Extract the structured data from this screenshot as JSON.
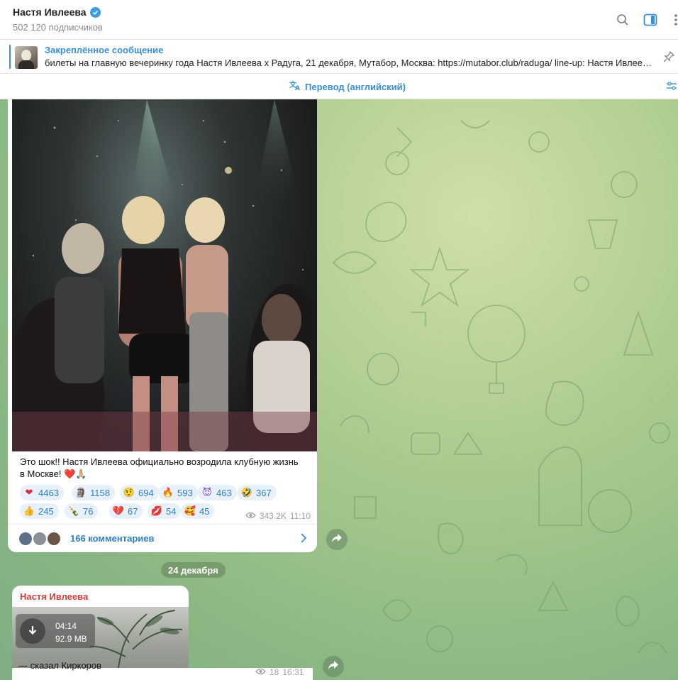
{
  "header": {
    "channel_name": "Настя Ивлеева",
    "subscribers": "502 120 подписчиков",
    "icons": [
      "search-icon",
      "sidebar-toggle-icon",
      "more-icon"
    ]
  },
  "pinned": {
    "title": "Закреплённое сообщение",
    "text": "билеты на главную вечеринку года Настя Ивлеева х Радуга, 21 декабря, Мутабор, Москва:   https://mutabor.club/raduga/  line-up:   Настя Ивлеева, Тимур..."
  },
  "translate": {
    "label": "Перевод (английский)"
  },
  "message1": {
    "caption_line1": "Это шок!! Настя Ивлеева официально возродила клубную жизнь",
    "caption_line2": "в Москве! ❤️🙏🏼",
    "reactions": [
      {
        "emoji": "❤",
        "count": "4463",
        "color": "#e0283a"
      },
      {
        "emoji": "🗿",
        "count": "1158",
        "color": "#777777"
      },
      {
        "emoji": "🤨",
        "count": "694",
        "color": "#e8b422"
      },
      {
        "emoji": "🔥",
        "count": "593",
        "color": "#f06a1d"
      },
      {
        "emoji": "😈",
        "count": "463",
        "color": "#8a4fc8"
      },
      {
        "emoji": "🤣",
        "count": "367",
        "color": "#e8b422"
      },
      {
        "emoji": "👍",
        "count": "245",
        "color": "#e8b422"
      },
      {
        "emoji": "🍾",
        "count": "76",
        "color": "#3c8a3c"
      },
      {
        "emoji": "💔",
        "count": "67",
        "color": "#e0283a"
      },
      {
        "emoji": "💋",
        "count": "54",
        "color": "#e0283a"
      },
      {
        "emoji": "🥰",
        "count": "45",
        "color": "#e8b422"
      }
    ],
    "views": "343.2K",
    "time": "11:10",
    "comments": "166 комментариев"
  },
  "date_separator": "24 декабря",
  "message2": {
    "author": "Настя Ивлеева",
    "duration": "04:14",
    "size": "92.9 MB",
    "caption": "— сказал Киркоров",
    "views": "18",
    "time": "16:31"
  },
  "colors": {
    "accent": "#3a8fd6",
    "author_red": "#d2413c",
    "reaction_bg": "#e8f1fb"
  }
}
